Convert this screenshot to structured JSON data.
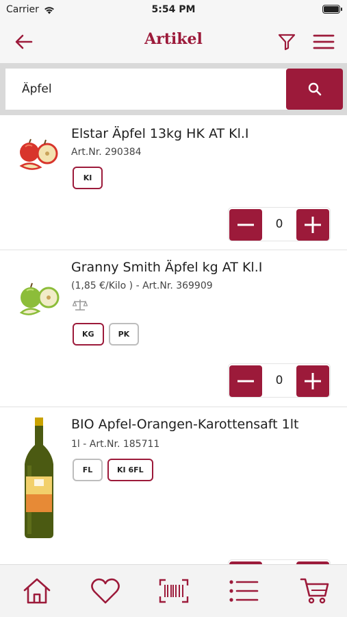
{
  "status_bar": {
    "carrier": "Carrier",
    "time": "5:54 PM"
  },
  "header": {
    "title": "Artikel"
  },
  "search": {
    "value": "Äpfel",
    "placeholder": ""
  },
  "products": [
    {
      "title": "Elstar Äpfel 13kg HK AT Kl.I",
      "subtitle": "Art.Nr. 290384",
      "units": [
        {
          "label": "KI",
          "active": true
        }
      ],
      "quantity": "0",
      "image": "red-apples-icon"
    },
    {
      "title": "Granny Smith Äpfel kg AT Kl.I",
      "subtitle": "(1,85 €/Kilo )  -  Art.Nr. 369909",
      "units": [
        {
          "label": "KG",
          "active": true
        },
        {
          "label": "PK",
          "active": false
        }
      ],
      "quantity": "0",
      "image": "green-apples-icon"
    },
    {
      "title": "BIO Apfel-Orangen-Karottensaft 1lt",
      "subtitle": "1l  -  Art.Nr. 185711",
      "units": [
        {
          "label": "FL",
          "active": false
        },
        {
          "label": "KI 6FL",
          "active": true
        }
      ],
      "image": "juice-bottle-icon"
    }
  ],
  "tab_bar": {
    "items": [
      "home-icon",
      "heart-icon",
      "barcode-icon",
      "list-icon",
      "cart-icon"
    ]
  },
  "colors": {
    "accent": "#9c1a3a",
    "background": "#f6f6f6"
  }
}
